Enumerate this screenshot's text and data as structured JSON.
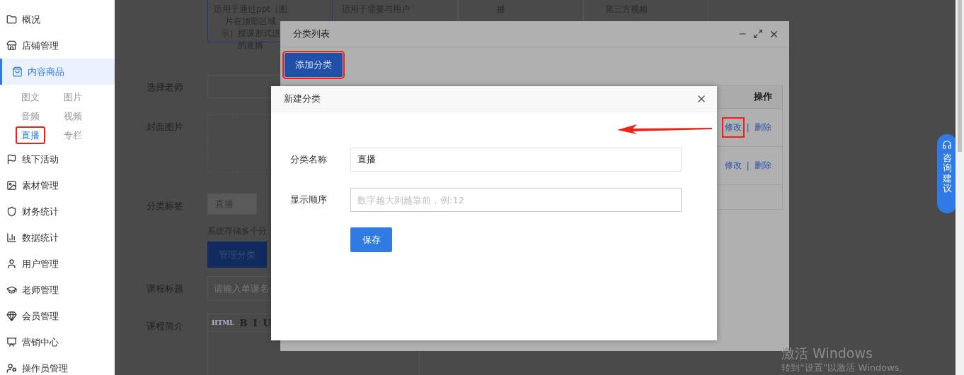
{
  "sidebar": {
    "items": [
      {
        "label": "概况",
        "selected": false
      },
      {
        "label": "店铺管理",
        "selected": false
      },
      {
        "label": "内容商品",
        "selected": true,
        "children": [
          {
            "label": "图文",
            "selected": false,
            "highlighted": false
          },
          {
            "label": "图片",
            "selected": false,
            "highlighted": false
          },
          {
            "label": "音频",
            "selected": false,
            "highlighted": false
          },
          {
            "label": "视频",
            "selected": false,
            "highlighted": false
          },
          {
            "label": "直播",
            "selected": true,
            "highlighted": true
          },
          {
            "label": "专栏",
            "selected": false,
            "highlighted": false
          }
        ]
      },
      {
        "label": "线下活动",
        "selected": false
      },
      {
        "label": "素材管理",
        "selected": false
      },
      {
        "label": "财务统计",
        "selected": false
      },
      {
        "label": "数据统计",
        "selected": false
      },
      {
        "label": "用户管理",
        "selected": false
      },
      {
        "label": "老师管理",
        "selected": false
      },
      {
        "label": "会员管理",
        "selected": false
      },
      {
        "label": "营销中心",
        "selected": false
      },
      {
        "label": "操作员管理",
        "selected": false
      }
    ]
  },
  "course_types": [
    {
      "lines": [
        "适用于通过ppt（图",
        "片在顶部区域",
        "示）授课形式进",
        "的直播"
      ],
      "selected": true
    },
    {
      "lines": [
        "适用于需要与用户"
      ],
      "selected": false
    },
    {
      "lines": [
        "播"
      ],
      "selected": false
    },
    {
      "lines": [
        "第三方视频"
      ],
      "selected": false
    }
  ],
  "form": {
    "teacher_label": "选择老师",
    "cover_label": "封面图片",
    "tag_label": "分类标签",
    "tag_chip": "直播",
    "tag_hint": "系统存储多个分",
    "manage_button": "管理分类",
    "title_label": "课程标题",
    "title_placeholder": "请输入单课名",
    "intro_label": "课程简介",
    "editor_tools": [
      "HTML",
      "B",
      "I",
      "U"
    ]
  },
  "category_list": {
    "title": "分类列表",
    "add_button": {
      "label": "添加分类",
      "highlighted": true
    },
    "table": {
      "columns": [
        "操作"
      ],
      "rows": [
        {
          "actions": [
            {
              "label": "修改",
              "highlighted": true
            },
            {
              "label": "删除",
              "highlighted": false
            }
          ],
          "separator": "|"
        },
        {
          "actions": [
            {
              "label": "修改",
              "highlighted": false
            },
            {
              "label": "删除",
              "highlighted": false
            }
          ],
          "separator": "|"
        }
      ]
    }
  },
  "new_category": {
    "title": "新建分类",
    "fields": [
      {
        "label": "分类名称",
        "value": "直播"
      },
      {
        "label": "显示顺序",
        "placeholder": "数字越大则越靠前，例:12"
      }
    ],
    "save_button": "保存"
  },
  "consult_button": "咨询建议",
  "os_notice": {
    "title": "激活 Windows",
    "subtitle": "转到“设置”以激活 Windows。"
  }
}
